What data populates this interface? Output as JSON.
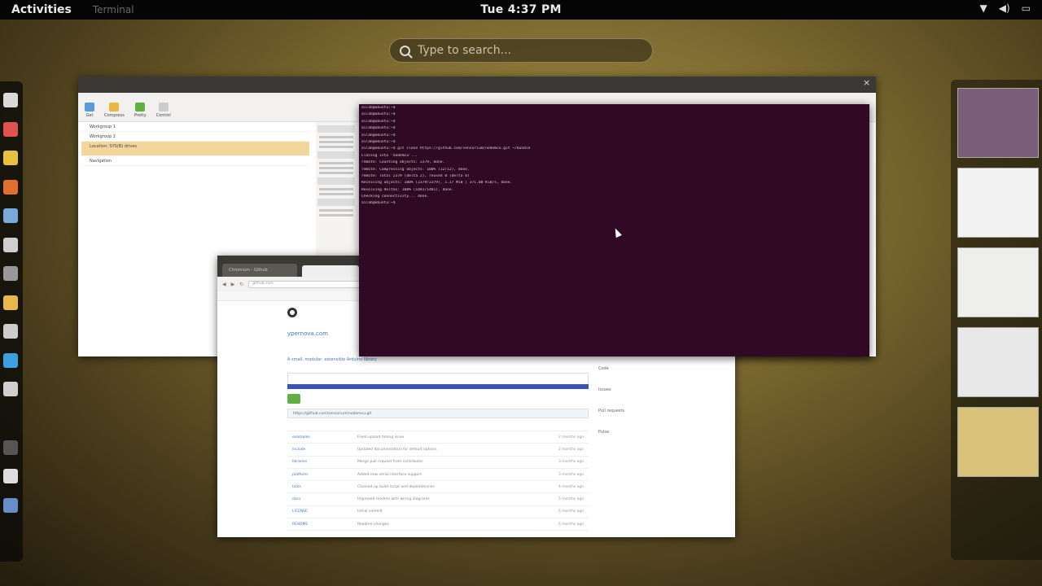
{
  "top_panel": {
    "activities": "Activities",
    "app_menu": "Terminal",
    "clock": "Tue  4:37 PM"
  },
  "search": {
    "placeholder": "Type to search..."
  },
  "dash": {
    "icons": [
      {
        "name": "nautilus-icon",
        "color": "#d9d9d9"
      },
      {
        "name": "software-icon",
        "color": "#e05252"
      },
      {
        "name": "chrome-icon",
        "color": "#e8c040"
      },
      {
        "name": "firefox-icon",
        "color": "#e07030"
      },
      {
        "name": "document-icon",
        "color": "#7aa8d8"
      },
      {
        "name": "files-icon",
        "color": "#cfcfcf"
      },
      {
        "name": "calc-icon",
        "color": "#999999"
      },
      {
        "name": "tasks-icon",
        "color": "#e8b84a"
      },
      {
        "name": "editor-icon",
        "color": "#cccccc"
      },
      {
        "name": "skype-icon",
        "color": "#3ca0e0"
      },
      {
        "name": "disk-icon",
        "color": "#cfcfcf"
      },
      {
        "name": "terminal-app-icon",
        "color": "#555555"
      },
      {
        "name": "text-icon",
        "color": "#dddddd"
      },
      {
        "name": "settings-icon",
        "color": "#6a8cc8"
      }
    ]
  },
  "terminal": {
    "lines": [
      "ailab@ubuntu:~$",
      "ailab@ubuntu:~$",
      "ailab@ubuntu:~$",
      "ailab@ubuntu:~$",
      "ailab@ubuntu:~$",
      "ailab@ubuntu:~$",
      "ailab@ubuntu:~$ git clone https://github.com/sensorium/nodemcu.git ~/bundle",
      "Cloning into 'nodemcu'...",
      "remote: Counting objects: 2379, done.",
      "remote: Compressing objects: 100% (12/12), done.",
      "remote: Total 2379 (delta 2), reused 0 (delta 0)",
      "Receiving objects: 100% (2379/2379), 1.17 MiB | 371.00 KiB/s, done.",
      "Resolving deltas: 100% (1481/1481), done.",
      "Checking connectivity... done.",
      "ailab@ubuntu:~$"
    ]
  },
  "file_manager": {
    "toolbar": [
      "Get",
      "Compress",
      "Pretty",
      "Control"
    ],
    "rows": [
      "Workgroup 1",
      "Workgroup 2",
      "Location: SYS(B) drives",
      "Navigation"
    ]
  },
  "browser": {
    "tab": "Chromium - Github",
    "url": "github.com",
    "repo": "ypernova.com",
    "description": "A small, modular, extensible Arduino library",
    "clone_url": "https://github.com/sensorium/nodemcu.git",
    "files": [
      {
        "name": "examples",
        "msg": "Fixed upload timing issue",
        "age": "2 months ago"
      },
      {
        "name": "include",
        "msg": "Updated documentation for default options",
        "age": "2 months ago"
      },
      {
        "name": "libraries",
        "msg": "Merge pull request from contributor",
        "age": "3 months ago"
      },
      {
        "name": "platform",
        "msg": "Added new serial interface support",
        "age": "3 months ago"
      },
      {
        "name": "tools",
        "msg": "Cleaned up build script and dependencies",
        "age": "4 months ago"
      },
      {
        "name": "docs",
        "msg": "Improved readme with wiring diagrams",
        "age": "5 months ago"
      },
      {
        "name": "LICENSE",
        "msg": "Initial commit",
        "age": "6 months ago"
      },
      {
        "name": "README",
        "msg": "Readme changes",
        "age": "6 months ago"
      }
    ],
    "side": [
      "Code",
      "Issues",
      "Pull requests",
      "Pulse"
    ]
  },
  "workspaces": [
    {
      "color": "#7a5e78"
    },
    {
      "color": "#f2f2f2"
    },
    {
      "color": "#eeeeea"
    },
    {
      "color": "#e8e8e8"
    },
    {
      "color": "#d9c27a"
    }
  ]
}
